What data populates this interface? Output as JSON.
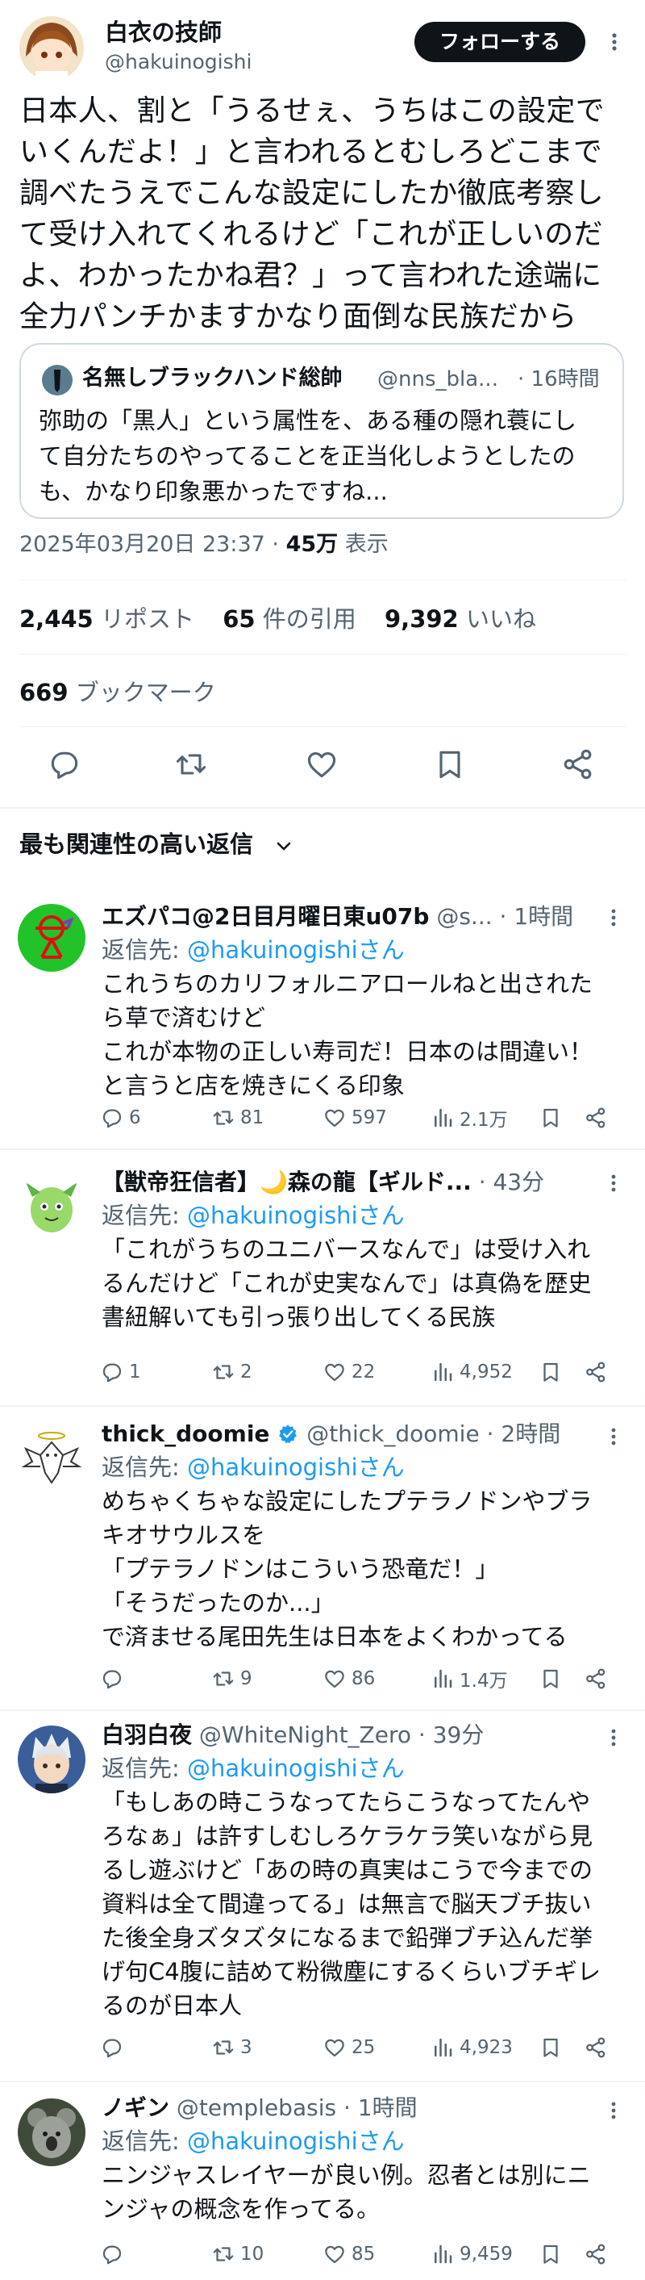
{
  "main_tweet": {
    "author_name": "白衣の技師",
    "author_handle": "@hakuinogishi",
    "follow_label": "フォローする",
    "text_lines": [
      "日本人、割と「うるせぇ、うちはこの設定で",
      "いくんだよ！」と言われるとむしろどこまで",
      "調べたうえでこんな設定にしたか徹底考察し",
      "て受け入れてくれるけど「これが正しいのだ",
      "よ、わかったかね君？」って言われた途端に",
      "全力パンチかますかなり面倒な民族だから"
    ],
    "quote": {
      "name": "名無しブラックハンド総帥",
      "handle": "@nns_bla...",
      "time": "· 16時間",
      "text_lines": [
        "弥助の「黒人」という属性を、ある種の隠れ蓑にし",
        "て自分たちのやってることを正当化しようとしたの",
        "も、かなり印象悪かったですね..."
      ]
    },
    "timestamp": "2025年03月20日 23:37 · ",
    "views_count": "45万",
    "views_label": " 表示",
    "stats": {
      "reposts_count": "2,445",
      "reposts_label": "リポスト",
      "quotes_count": "65",
      "quotes_label": "件の引用",
      "likes_count": "9,392",
      "likes_label": "いいね",
      "bookmarks_count": "669",
      "bookmarks_label": "ブックマーク"
    }
  },
  "replies_section": {
    "sort_label": "最も関連性の高い返信"
  },
  "replies": [
    {
      "name": "エズパコ@2日目月曜日東u07b",
      "handle": "@s...",
      "time": "· 1時間",
      "reply_prefix": "返信先: ",
      "reply_handle": "@hakuinogishiさん",
      "text_lines": [
        "これうちのカリフォルニアロールねと出されたら草で済むけど",
        "これが本物の正しい寿司だ！日本のは間違い！",
        "と言うと店を焼きにくる印象"
      ],
      "text_lines_display": [
        "これうちのカリフォルニアロールねと出された",
        "ら草で済むけど",
        "これが本物の正しい寿司だ！日本のは間違い！",
        "と言うと店を焼きにくる印象"
      ],
      "replies": "6",
      "reposts": "81",
      "likes": "597",
      "views": "2.1万"
    },
    {
      "name": "【獣帝狂信者】🌙森の龍【ギルド...",
      "handle": "",
      "time": "· 43分",
      "reply_prefix": "返信先: ",
      "reply_handle": "@hakuinogishiさん",
      "text_lines_display": [
        "「これがうちのユニバースなんで」は受け入れ",
        "るんだけど「これが史実なんで」は真偽を歴史",
        "書紐解いても引っ張り出してくる民族"
      ],
      "replies": "1",
      "reposts": "2",
      "likes": "22",
      "views": "4,952"
    },
    {
      "name": "thick_doomie",
      "handle": "@thick_doomie",
      "time": "· 2時間",
      "reply_prefix": "返信先: ",
      "reply_handle": "@hakuinogishiさん",
      "text_lines_display": [
        "めちゃくちゃな設定にしたプテラノドンやブラ",
        "キオサウルスを",
        "「プテラノドンはこういう恐竜だ！」",
        "「そうだったのか...」",
        "で済ませる尾田先生は日本をよくわかってる"
      ],
      "replies": "",
      "reposts": "9",
      "likes": "86",
      "views": "1.4万"
    },
    {
      "name": "白羽白夜",
      "handle": "@WhiteNight_Zero",
      "time": "· 39分",
      "reply_prefix": "返信先: ",
      "reply_handle": "@hakuinogishiさん",
      "text_lines_display": [
        "「もしあの時こうなってたらこうなってたんや",
        "ろなぁ」は許すしむしろケラケラ笑いながら見",
        "るし遊ぶけど「あの時の真実はこうで今までの",
        "資料は全て間違ってる」は無言で脳天ブチ抜い",
        "た後全身ズタズタになるまで鉛弾ブチ込んだ挙",
        "げ句C4腹に詰めて粉微塵にするくらいブチギレ",
        "るのが日本人"
      ],
      "replies": "",
      "reposts": "3",
      "likes": "25",
      "views": "4,923"
    },
    {
      "name": "ノギン",
      "handle": "@templebasis",
      "time": "· 1時間",
      "reply_prefix": "返信先: ",
      "reply_handle": "@hakuinogishiさん",
      "text_lines_display": [
        "ニンジャスレイヤーが良い例。忍者とは別にニ",
        "ンジャの概念を作ってる。"
      ],
      "replies": "",
      "reposts": "10",
      "likes": "85",
      "views": "9,459"
    }
  ],
  "colors": {
    "text": "#0f1419",
    "muted": "#536471",
    "link": "#1d9bf0",
    "border": "#cfd9de",
    "divider": "#eff3f4",
    "verified": "#1d9bf0"
  },
  "icons": {
    "actions": [
      "reply-icon",
      "repost-icon",
      "like-icon",
      "bookmark-icon",
      "share-icon"
    ],
    "reply_actions": [
      "reply-icon",
      "repost-icon",
      "like-icon",
      "views-icon",
      "bookmark-icon",
      "share-icon"
    ],
    "more": "more-icon",
    "sort": "chevron-down-icon",
    "verified": "verified-badge-icon"
  }
}
